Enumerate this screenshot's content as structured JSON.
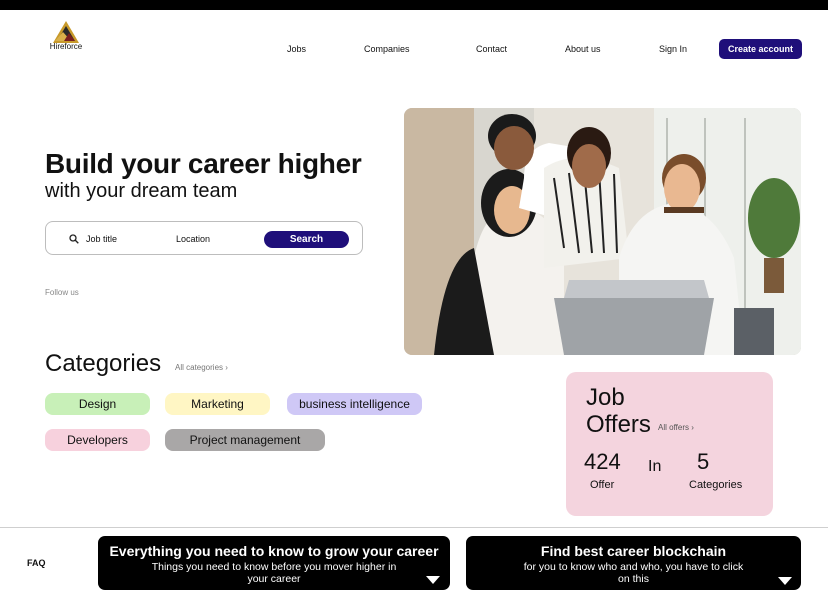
{
  "header": {
    "logo_text": "Hireforce",
    "nav": [
      "Jobs",
      "Companies",
      "Contact",
      "About us",
      "Sign In"
    ],
    "create_account": "Create account"
  },
  "hero": {
    "title": "Build your career higher",
    "subtitle": "with your dream team",
    "search": {
      "job_placeholder": "Job title",
      "location_placeholder": "Location",
      "button": "Search"
    },
    "follow_us": "Follow us"
  },
  "categories": {
    "title": "Categories",
    "all_link": "All categories",
    "items": [
      {
        "label": "Design",
        "color": "#c8f0b8"
      },
      {
        "label": "Marketing",
        "color": "#fff6c4"
      },
      {
        "label": "business intelligence",
        "color": "#cfc8f6"
      },
      {
        "label": "Developers",
        "color": "#f7d1dd"
      },
      {
        "label": "Project management",
        "color": "#a9a7a7"
      }
    ]
  },
  "job_offers": {
    "title": "Job Offers",
    "all_link": "All offers",
    "offer_count": "424",
    "offer_label": "Offer",
    "in_word": "In",
    "category_count": "5",
    "category_label": "Categories",
    "background": "#f4d4de"
  },
  "footer": {
    "faq": "FAQ",
    "banner_left": {
      "title": "Everything you need to know to grow your career",
      "text": "Things you need to know before you mover higher in your career"
    },
    "banner_right": {
      "title": "Find best career blockchain",
      "text": "for you to know who and who, you have to click on this"
    }
  },
  "colors": {
    "brand": "#1f0f7a",
    "top_bar": "#000000",
    "banner": "#000000"
  },
  "icons": [
    "logo-mountain-icon",
    "search-icon",
    "chevron-right-icon",
    "dropdown-triangle-icon"
  ]
}
